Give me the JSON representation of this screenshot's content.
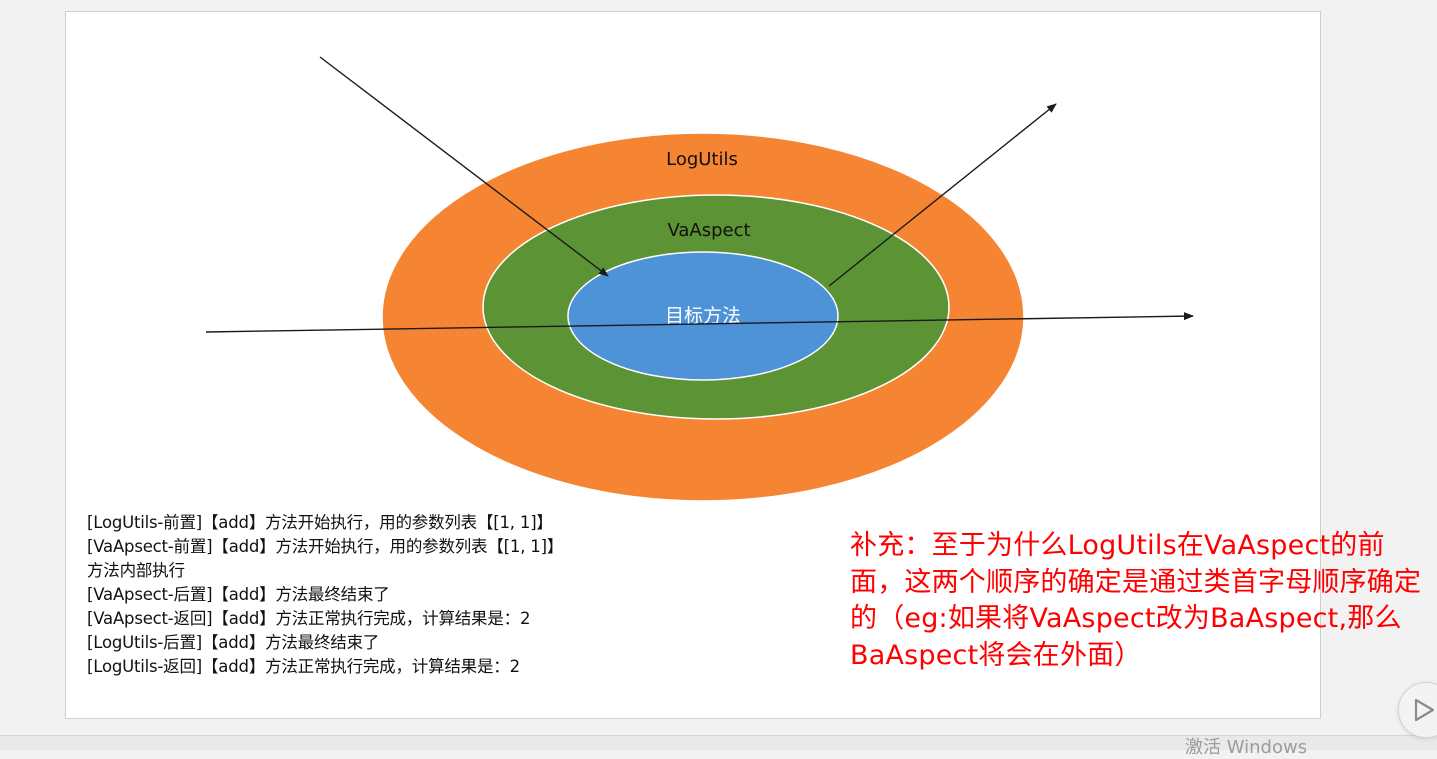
{
  "diagram": {
    "outer_label": "LogUtils",
    "middle_label": "VaAspect",
    "inner_label": "目标方法",
    "colors": {
      "outer": "#f58532",
      "middle": "#5b9335",
      "inner": "#4e92d8",
      "arrow": "#1a1a1a"
    }
  },
  "log_lines": [
    "[LogUtils-前置]【add】方法开始执行，用的参数列表【[1, 1]】",
    "[VaApsect-前置]【add】方法开始执行，用的参数列表【[1, 1]】",
    "方法内部执行",
    "[VaApsect-后置]【add】方法最终结束了",
    "[VaApsect-返回]【add】方法正常执行完成，计算结果是：2",
    "[LogUtils-后置]【add】方法最终结束了",
    "[LogUtils-返回]【add】方法正常执行完成，计算结果是：2"
  ],
  "note": {
    "text": "补充：至于为什么LogUtils在VaAspect的前面，这两个顺序的确定是通过类首字母顺序确定的（eg:如果将VaAspect改为BaAspect,那么BaAspect将会在外面）",
    "color": "#ff0000"
  },
  "watermark": {
    "text": "激活 Windows"
  },
  "player": {
    "icon": "play-icon"
  }
}
